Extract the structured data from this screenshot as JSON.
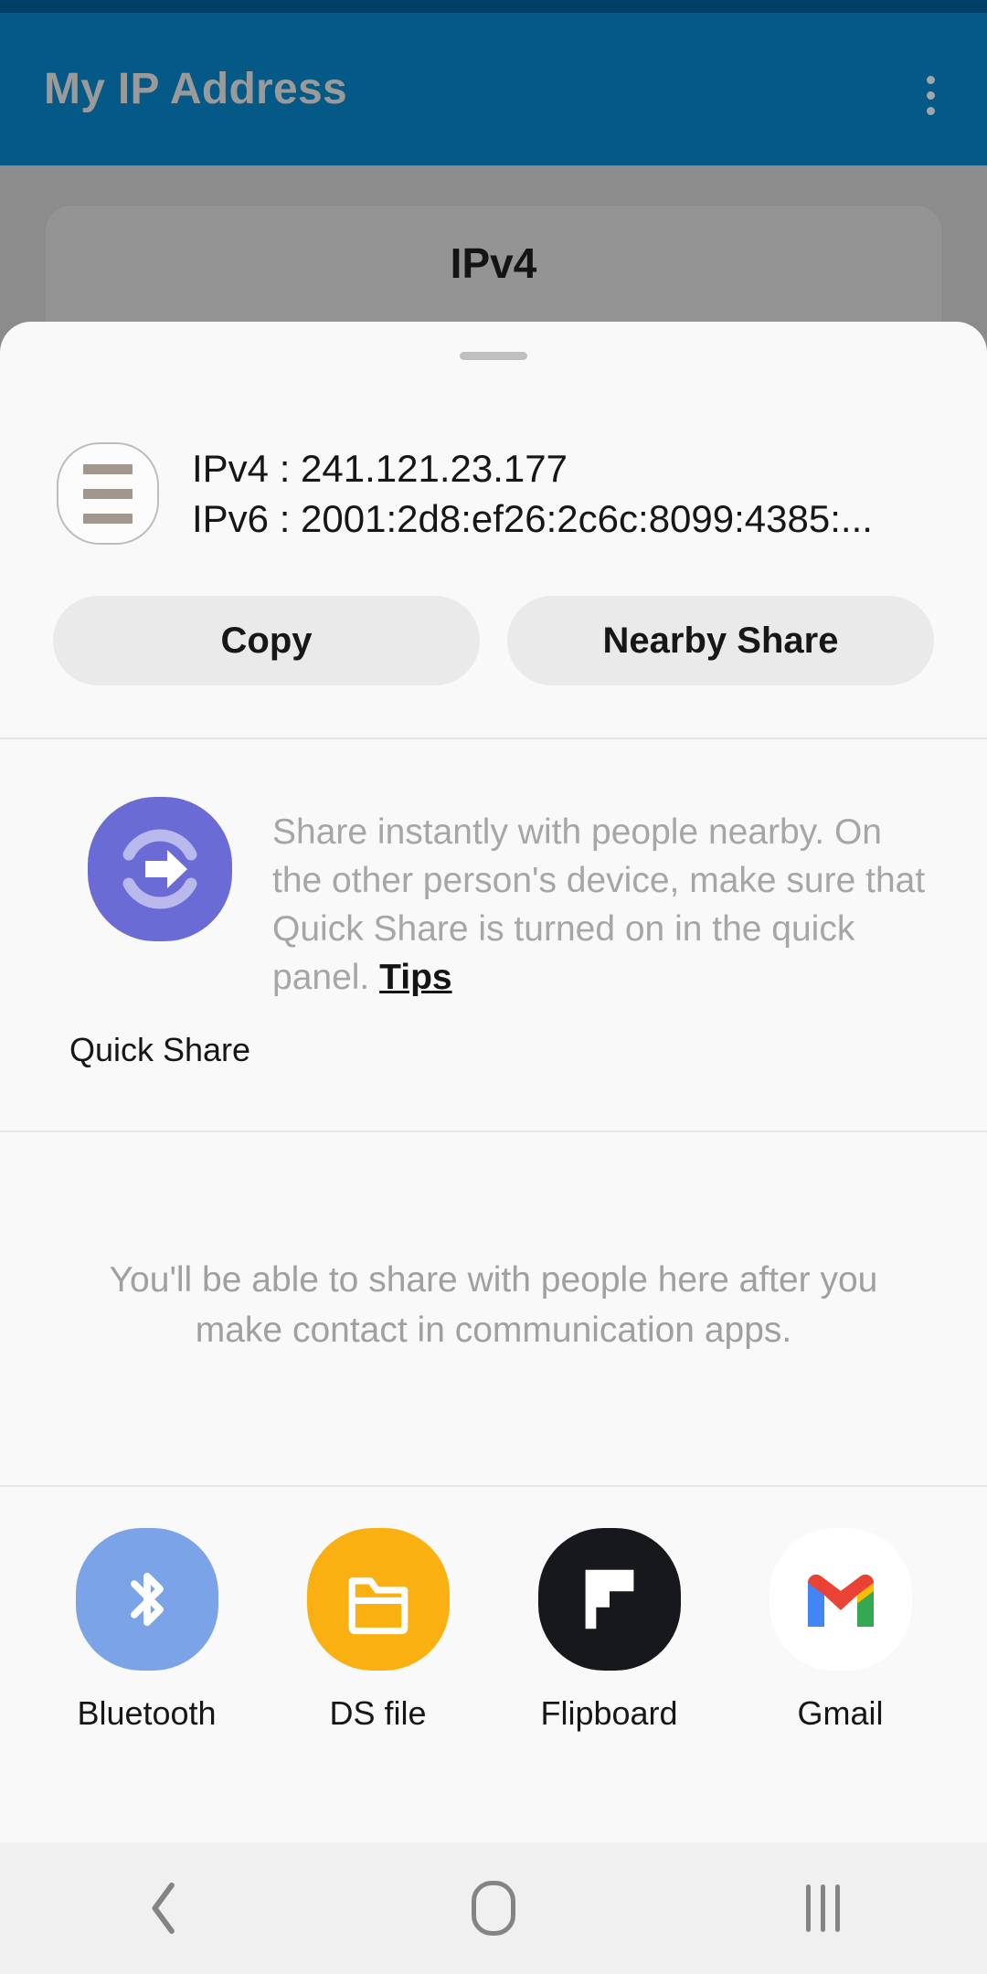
{
  "appbar": {
    "title": "My IP Address",
    "overflow_icon": "more-vertical-icon"
  },
  "background_page": {
    "card_title": "IPv4"
  },
  "sheet": {
    "ip_icon": "list-lines-icon",
    "ipv4_line": "IPv4 : 241.121.23.177",
    "ipv6_line": "IPv6 : 2001:2d8:ef26:2c6c:8099:4385:...",
    "actions": {
      "copy_label": "Copy",
      "nearby_share_label": "Nearby Share"
    },
    "quick_share": {
      "icon": "quick-share-icon",
      "label": "Quick Share",
      "description": "Share instantly with people nearby. On the other person's device, make sure that Quick Share is turned on in the quick panel. ",
      "tips_label": "Tips"
    },
    "empty_state": "You'll be able to share with people here after you make contact in communication apps.",
    "apps": [
      {
        "name": "Bluetooth",
        "icon": "bluetooth-icon"
      },
      {
        "name": "DS file",
        "icon": "folder-icon"
      },
      {
        "name": "Flipboard",
        "icon": "flipboard-icon"
      },
      {
        "name": "Gmail",
        "icon": "gmail-icon"
      }
    ]
  },
  "navbar": {
    "back": "back-chevron-icon",
    "home": "home-icon",
    "recents": "recents-icon"
  },
  "colors": {
    "appbar_blue": "#055986",
    "status_blue": "#003F66",
    "scrim_gray": "#8C8C8C",
    "sheet_bg": "#F9F9F9",
    "quick_share_purple": "#6B6BD6",
    "bluetooth_blue": "#7BA3E8",
    "dsfile_orange": "#FBB012",
    "flipboard_black": "#17181C"
  }
}
